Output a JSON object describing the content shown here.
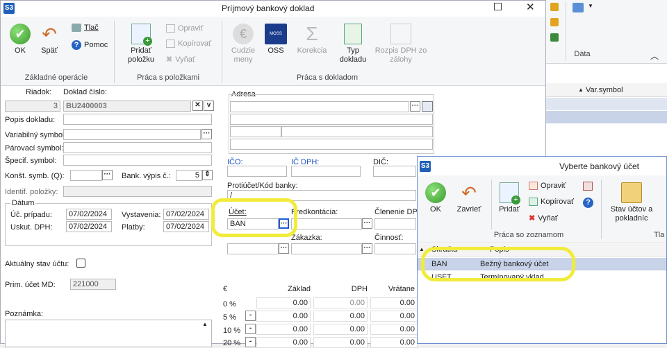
{
  "main_window": {
    "title": "Príjmový bankový doklad",
    "app_badge": "S3",
    "ribbon": {
      "ok": "OK",
      "back": "Späť",
      "print": "Tlač",
      "help": "Pomoc",
      "add_item": "Pridať položku",
      "edit": "Opraviť",
      "copy": "Kopírovať",
      "remove": "Vyňať",
      "foreign": "Cudzie meny",
      "oss": "OSS",
      "oss_badge": "MOSS",
      "correction": "Korekcia",
      "doc_type": "Typ dokladu",
      "vat_breakdown": "Rozpis DPH zo zálohy",
      "group_basic": "Základné operácie",
      "group_items": "Práca s položkami",
      "group_doc": "Práca s dokladom"
    },
    "form": {
      "row_label": "Riadok:",
      "row_value": "3",
      "doc_no_label": "Doklad číslo:",
      "doc_no_value": "BU2400003",
      "desc_label": "Popis dokladu:",
      "var_symbol_label": "Variabilný symbol:",
      "pair_symbol_label": "Párovací symbol:",
      "spec_symbol_label": "Špecif. symbol:",
      "const_symbol_label": "Konšt. symb. (Q):",
      "bank_stmt_label": "Bank. výpis č.:",
      "bank_stmt_value": "5",
      "item_id_label": "Identif. položky:",
      "date_group": "Dátum",
      "acc_case_label": "Úč. prípadu:",
      "acc_case_value": "07/02/2024",
      "issued_label": "Vystavenia:",
      "issued_value": "07/02/2024",
      "vat_label": "Uskut. DPH:",
      "vat_value": "07/02/2024",
      "payment_label": "Platby:",
      "payment_value": "07/02/2024",
      "current_state_label": "Aktuálny stav účtu:",
      "prim_account_label": "Prim. účet MD:",
      "prim_account_value": "221000",
      "note_label": "Poznámka:",
      "address_label": "Adresa",
      "ico_label": "IČO:",
      "ic_dph_label": "IČ DPH:",
      "dic_label": "DIČ:",
      "counter_account_label": "Protiúčet/Kód banky:",
      "counter_account_value": "/",
      "account_label": "Účet:",
      "account_value": "BAN",
      "precontation_label": "Predkontácia:",
      "division_label": "Členenie DPH",
      "order_label": "Zákazka:",
      "activity_label": "Činnosť:",
      "vat_table": {
        "currency": "€",
        "col_base": "Základ",
        "col_vat": "DPH",
        "col_returned": "Vrátane",
        "rows": [
          {
            "rate": "0 %",
            "base": "0.00",
            "vat": "0.00",
            "returned": "0.00"
          },
          {
            "rate": "5 %",
            "base": "0.00",
            "vat": "0.00",
            "returned": "0.00"
          },
          {
            "rate": "10 %",
            "base": "0.00",
            "vat": "0.00",
            "returned": "0.00"
          },
          {
            "rate": "20 %",
            "base": "0.00",
            "vat": "0.00",
            "returned": "0.00"
          }
        ]
      }
    }
  },
  "background": {
    "data_label": "Dáta",
    "var_symbol_header": "Var.symbol"
  },
  "dialog": {
    "app_badge": "S3",
    "title": "Vyberte bankový účet",
    "ribbon": {
      "ok": "OK",
      "close": "Zavrieť",
      "add": "Pridať",
      "edit": "Opraviť",
      "copy": "Kopírovať",
      "remove": "Vyňať",
      "accounts_state": "Stav účtov a pokladníc",
      "group_list": "Práca so zoznamom",
      "group_cut": "Tla"
    },
    "table": {
      "col_code": "Skratka",
      "col_desc": "Popis",
      "rows": [
        {
          "code": "BAN",
          "desc": "Bežný bankový účet"
        },
        {
          "code": "USFT",
          "desc": "Termínovaný vklad"
        }
      ]
    }
  }
}
